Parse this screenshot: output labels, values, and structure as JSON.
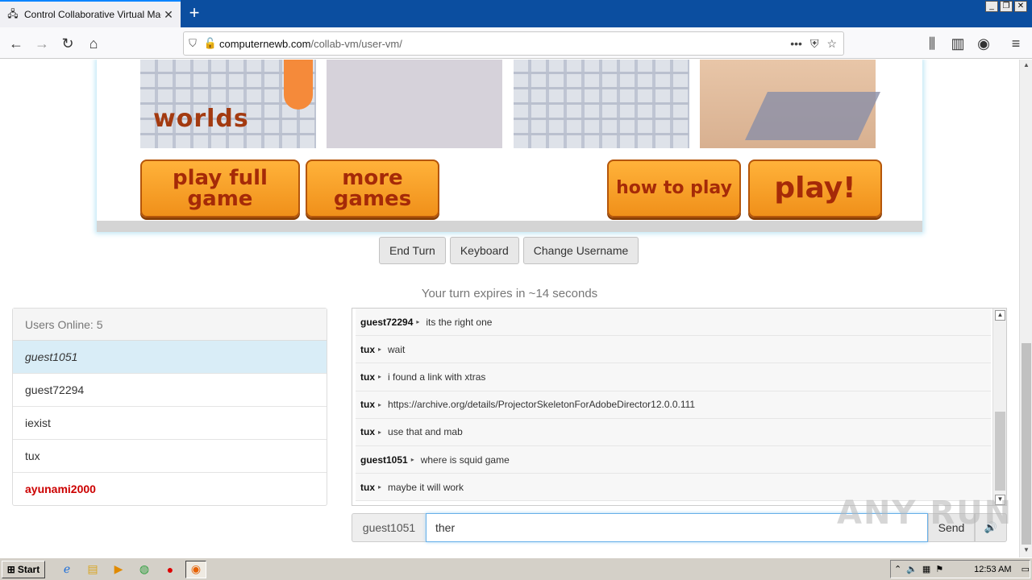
{
  "browser": {
    "tab_title": "Control Collaborative Virtual Machi",
    "tab_close": "✕",
    "new_tab": "+",
    "url_host": "computernewb.com",
    "url_path": "/collab-vm/user-vm/",
    "window_controls": [
      "_",
      "❐",
      "✕"
    ]
  },
  "game": {
    "worlds_label": "worlds",
    "buttons": [
      "play full game",
      "more games",
      "how to play",
      "play!"
    ]
  },
  "controls": {
    "end_turn": "End Turn",
    "keyboard": "Keyboard",
    "change_username": "Change Username"
  },
  "turn_text": "Your turn expires in ~14 seconds",
  "users": {
    "header": "Users Online: 5",
    "list": [
      "guest1051",
      "guest72294",
      "iexist",
      "tux",
      "ayunami2000"
    ]
  },
  "chat": {
    "messages": [
      {
        "user": "guest72294",
        "text": "its the right one"
      },
      {
        "user": "tux",
        "text": "wait"
      },
      {
        "user": "tux",
        "text": "i found a link with xtras"
      },
      {
        "user": "tux",
        "text": "https://archive.org/details/ProjectorSkeletonForAdobeDirector12.0.0.111"
      },
      {
        "user": "tux",
        "text": "use that and mab"
      },
      {
        "user": "guest1051",
        "text": "where is squid game"
      },
      {
        "user": "tux",
        "text": "maybe it will work"
      }
    ],
    "username": "guest1051",
    "input_value": "ther",
    "send_label": "Send"
  },
  "watermark": "ANY RUN",
  "taskbar": {
    "start_label": "Start",
    "clock": "12:53 AM"
  },
  "colors": {
    "accent": "#0a84ff",
    "admin_user": "#cc0000",
    "selected_user_bg": "#d9edf7",
    "game_button": "#f0901a"
  }
}
